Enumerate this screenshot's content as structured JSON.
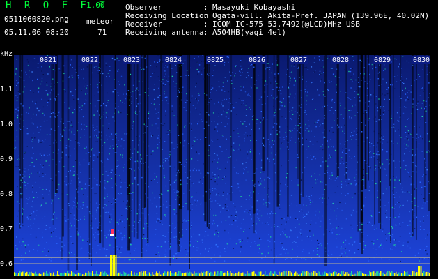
{
  "header": {
    "app_name": "H R O F F T",
    "version": "1.00",
    "file_name": "0511060820.png",
    "datetime": "05.11.06 08:20",
    "meteor_label": "meteor",
    "meteor_count": "71"
  },
  "info": [
    {
      "key": "Observer",
      "value": "Masayuki Kobayashi"
    },
    {
      "key": "Receiving Location",
      "value": "Ogata-vill. Akita-Pref. JAPAN (139.96E, 40.02N)"
    },
    {
      "key": "Receiver",
      "value": "ICOM IC-575 53.7492(@LCD)MHz USB"
    },
    {
      "key": "Receiving antenna",
      "value": "A504HB(yagi 4el)"
    }
  ],
  "separator": ":",
  "spectrogram": {
    "y_unit": "kHz",
    "y_ticks": [
      "1.1",
      "1.0",
      "0.9",
      "0.8",
      "0.7",
      "0.6"
    ],
    "time_ticks": [
      "0821",
      "0822",
      "0823",
      "0824",
      "0825",
      "0826",
      "0827",
      "0828",
      "0829",
      "0830"
    ],
    "colors": {
      "background": "#000000",
      "noise": "#1230b8",
      "noise_light": "#2a66ff",
      "signal": "#20d0a0",
      "echo": "#ffffff",
      "meteor": "#ffff00",
      "reference": "#a0a0a0"
    }
  }
}
